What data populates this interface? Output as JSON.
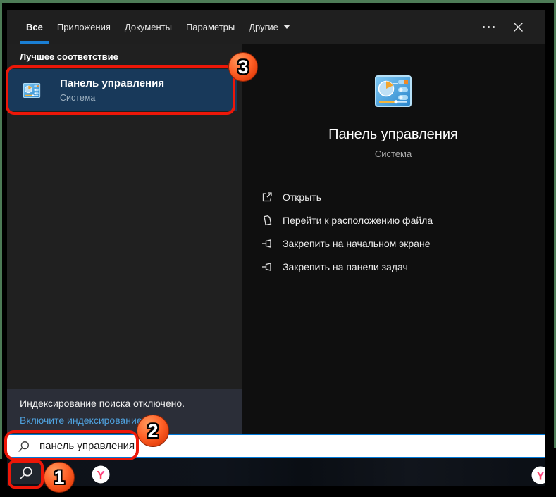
{
  "tabs": {
    "items": [
      {
        "label": "Все",
        "active": true
      },
      {
        "label": "Приложения",
        "active": false
      },
      {
        "label": "Документы",
        "active": false
      },
      {
        "label": "Параметры",
        "active": false
      },
      {
        "label": "Другие",
        "active": false,
        "has_dropdown": true
      }
    ]
  },
  "window_controls": {
    "see_more_icon": "ellipsis",
    "close_icon": "close-x"
  },
  "left": {
    "section_header": "Лучшее соответствие",
    "result": {
      "icon": "control-panel-icon",
      "title": "Панель управления",
      "subtitle": "Система",
      "selected": true
    },
    "status": {
      "line1": "Индексирование поиска отключено.",
      "link": "Включите индексирование."
    }
  },
  "preview": {
    "icon": "control-panel-icon",
    "title": "Панель управления",
    "subtitle": "Система",
    "actions": [
      {
        "icon": "open-icon",
        "label": "Открыть"
      },
      {
        "icon": "file-location-icon",
        "label": "Перейти к расположению файла"
      },
      {
        "icon": "pin-icon",
        "label": "Закрепить на начальном экране"
      },
      {
        "icon": "pin-icon",
        "label": "Закрепить на панели задач"
      }
    ]
  },
  "search": {
    "icon": "search-icon",
    "value": "панель управления"
  },
  "taskbar": {
    "buttons": [
      {
        "icon": "search-icon"
      },
      {
        "icon": "yandex-browser-icon"
      },
      {
        "icon": "yandex-browser-icon-partial"
      }
    ]
  },
  "annotations": {
    "steps": [
      "1",
      "2",
      "3"
    ]
  },
  "colors": {
    "accent_blue": "#0078d7",
    "tab_underline": "#1a7fd4",
    "selected_item": "#18395a",
    "link_blue": "#4fa3e0",
    "status_bg": "#2b2e38",
    "annotation_red": "#ed1708",
    "annotation_orange": "#ff6228",
    "desktop_green": "#4d7b56",
    "window_bg": "#1f1f1f",
    "preview_bg": "#0f0f0f"
  }
}
